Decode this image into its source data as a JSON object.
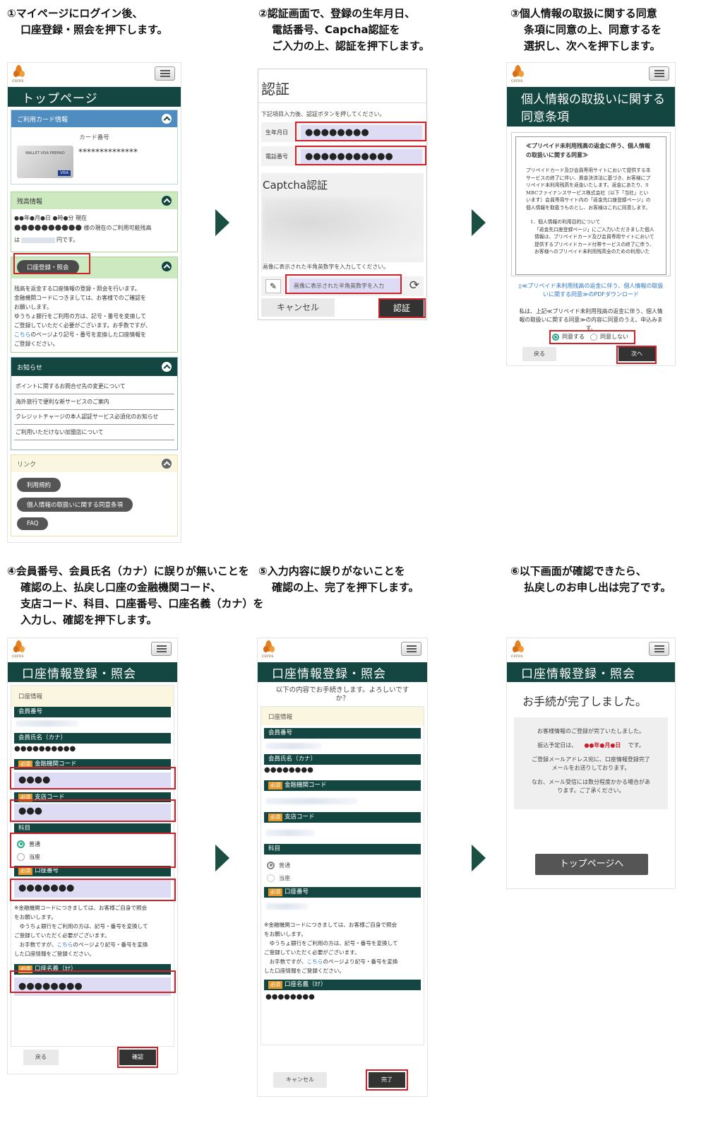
{
  "steps": [
    {
      "lines": [
        "①マイページにログイン後、",
        "口座登録・照会を押下します。"
      ]
    },
    {
      "lines": [
        "②認証画面で、登録の生年月日、",
        "電話番号、Capcha認証を",
        "ご入力の上、認証を押下します。"
      ]
    },
    {
      "lines": [
        "③個人情報の取扱に関する同意",
        "条項に同意の上、同意するを",
        "選択し、次へを押下します。"
      ]
    },
    {
      "lines": [
        "④会員番号、会員氏名（カナ）に誤りが無いことを",
        "確認の上、払戻し口座の金融機関コード、",
        "支店コード、科目、口座番号、口座名義（カナ）を",
        "入力し、確認を押下します。"
      ]
    },
    {
      "lines": [
        "⑤入力内容に誤りがないことを",
        "確認の上、完了を押下します。"
      ]
    },
    {
      "lines": [
        "⑥以下画面が確認できたら、",
        "払戻しのお申し出は完了です。"
      ]
    }
  ],
  "brand": "ceres",
  "s1": {
    "title": "トップページ",
    "card_section": "ご利用カード情報",
    "card_no_label": "カード番号",
    "card_no": "**************",
    "card_brand": "WALLET VISA PREPAID",
    "visa": "VISA",
    "balance_section": "残高情報",
    "balance_l1": "●●年●月●日 ●時●分 現在",
    "balance_dots": "●●●●●●●●●●",
    "balance_l2": "様の現在のご利用可能残高",
    "balance_l3a": "は",
    "balance_l3b": "円です。",
    "account_btn": "口座登録・照会",
    "acc_text": [
      "残高を返金する口座情報の登録・照会を行います。",
      "金融機関コードにつきましては、お客様でのご確認を",
      "お願いします。",
      "ゆうちょ銀行をご利用の方は、記号・番号を変換して",
      "ご登録していただく必要がございます。お手数ですが、"
    ],
    "acc_link": "こちら",
    "acc_link_after": "のページより記号・番号を変換した口座情報を",
    "acc_last": "ご登録ください。",
    "news_section": "お知らせ",
    "news": [
      "ポイントに関するお問合せ先の変更について",
      "海外旅行で便利な新サービスのご案内",
      "クレジットチャージの本人認証サービス必須化のお知らせ",
      "ご利用いただけない加盟店について"
    ],
    "links_section": "リンク",
    "links": [
      "利用規約",
      "個人情報の取扱いに関する同意条項",
      "FAQ"
    ]
  },
  "s2": {
    "title": "認証",
    "instr": "下記項目入力後、認証ボタンを押してください。",
    "birth_label": "生年月日",
    "birth_val": "●●●●●●●●",
    "tel_label": "電話番号",
    "tel_val": "●●●●●●●●●●●",
    "captcha_title": "Captcha認証",
    "captcha_instr": "画像に表示された半角英数字を入力してください。",
    "captcha_placeholder": "画像に表示された半角英数字を入力",
    "cancel": "キャンセル",
    "submit": "認証"
  },
  "s3": {
    "title_l1": "個人情報の取扱いに関する",
    "title_l2": "同意条項",
    "doc_title_l1": "≪プリペイド未利用残高の返金に伴う、個人情報",
    "doc_title_l2": "の取扱いに関する同意≫",
    "doc_p1": [
      "プリペイドカード及び会員専用サイトにおいて提供する本",
      "サービスの終了に伴い、資金決済法に基づき、お客様にプ",
      "リペイド未利用残高を返金いたします。返金にあたり、S",
      "MBCファイナンスサービス株式会社（以下「当社」とい",
      "います）会員専用サイト内の「返金先口座登録ページ」の",
      "個人情報を取扱うものとし、お客様はこれに同意します。"
    ],
    "doc_p2": [
      "1．個人情報の利用目的について",
      "「返金先口座登録ページ」にご入力いただきました個人",
      "情報は、プリペイドカード及び会員専用サイトにおいて",
      "提供するプリペイドカード付帯サービスの終了に伴う、",
      "お客様へのプリペイド未利用残高全のための利用いた"
    ],
    "pdf_l1": "≪プリペイド未利用残高の返金に伴う、個人情報の取扱",
    "pdf_l2": "いに関する同意≫のPDFダウンロード",
    "agree_text": [
      "私は、上記≪プリペイド未利用残高の返金に伴う、個人情",
      "報の取扱いに関する同意≫の内容に同意のうえ、申込みま",
      "す。"
    ],
    "agree": "同意する",
    "disagree": "同意しない",
    "back": "戻る",
    "next": "次へ"
  },
  "s4": {
    "title": "口座情報登録・照会",
    "section": "口座情報",
    "member_no": "会員番号",
    "member_name": "会員氏名（カナ）",
    "member_name_val": "●●●●●●●●●●",
    "req": "必須",
    "bank_code": "金融機関コード",
    "bank_val": "●●●●",
    "branch_code": "支店コード",
    "branch_val": "●●●",
    "subject": "科目",
    "opt1": "普通",
    "opt2": "当座",
    "acct_no": "口座番号",
    "acct_val": "●●●●●●●",
    "note": [
      "※金融機関コードにつきましては、お客様ご自身で照会",
      "をお願いします。",
      "　ゆうちょ銀行をご利用の方は、記号・番号を変換して",
      "ご登録していただく必要がございます。",
      "　お手数ですが、"
    ],
    "note_link": "こちら",
    "note_after": "のページより記号・番号を変換",
    "note_last": "した口座情報をご登録ください。",
    "acct_name": "口座名義（ｶﾅ）",
    "acct_name_val": "●●●●●●●●",
    "back": "戻る",
    "confirm": "確認"
  },
  "s5": {
    "title": "口座情報登録・照会",
    "intro_l1": "以下の内容でお手続きします。よろしいです",
    "intro_l2": "か？",
    "section": "口座情報",
    "member_no": "会員番号",
    "member_name": "会員氏名（カナ）",
    "member_name_val": "●●●●●●●●",
    "req": "必須",
    "bank_code": "金融機関コード",
    "branch_code": "支店コード",
    "subject": "科目",
    "opt1": "普通",
    "opt2": "当座",
    "acct_no": "口座番号",
    "note": [
      "※金融機関コードにつきましては、お客様ご自身で照会",
      "をお願いします。",
      "　ゆうちょ銀行をご利用の方は、記号・番号を変換して",
      "ご登録していただく必要がございます。",
      "　お手数ですが、"
    ],
    "note_link": "こちら",
    "note_after": "のページより記号・番号を変換",
    "note_last": "した口座情報をご登録ください。",
    "acct_name": "口座名義（ｶﾅ）",
    "acct_name_val": "●●●●●●●●",
    "cancel": "キャンセル",
    "done": "完了"
  },
  "s6": {
    "title": "口座情報登録・照会",
    "heading": "お手続が完了しました。",
    "l1": "お客様情報のご登録が完了いたしました。",
    "l2a": "振込予定日は、",
    "l2b": "●●年●月●日",
    "l2c": "です。",
    "l3": [
      "ご登録メールアドレス宛に、口座情報登録完了",
      "メールをお送りしております。"
    ],
    "l4": [
      "なお、メール受信には数分程度かかる場合があ",
      "ります。ご了承ください。"
    ],
    "top_btn": "トップページへ"
  },
  "colors": {
    "header": "#134640",
    "highlight": "#d0202a",
    "field": "#dedcf5"
  }
}
